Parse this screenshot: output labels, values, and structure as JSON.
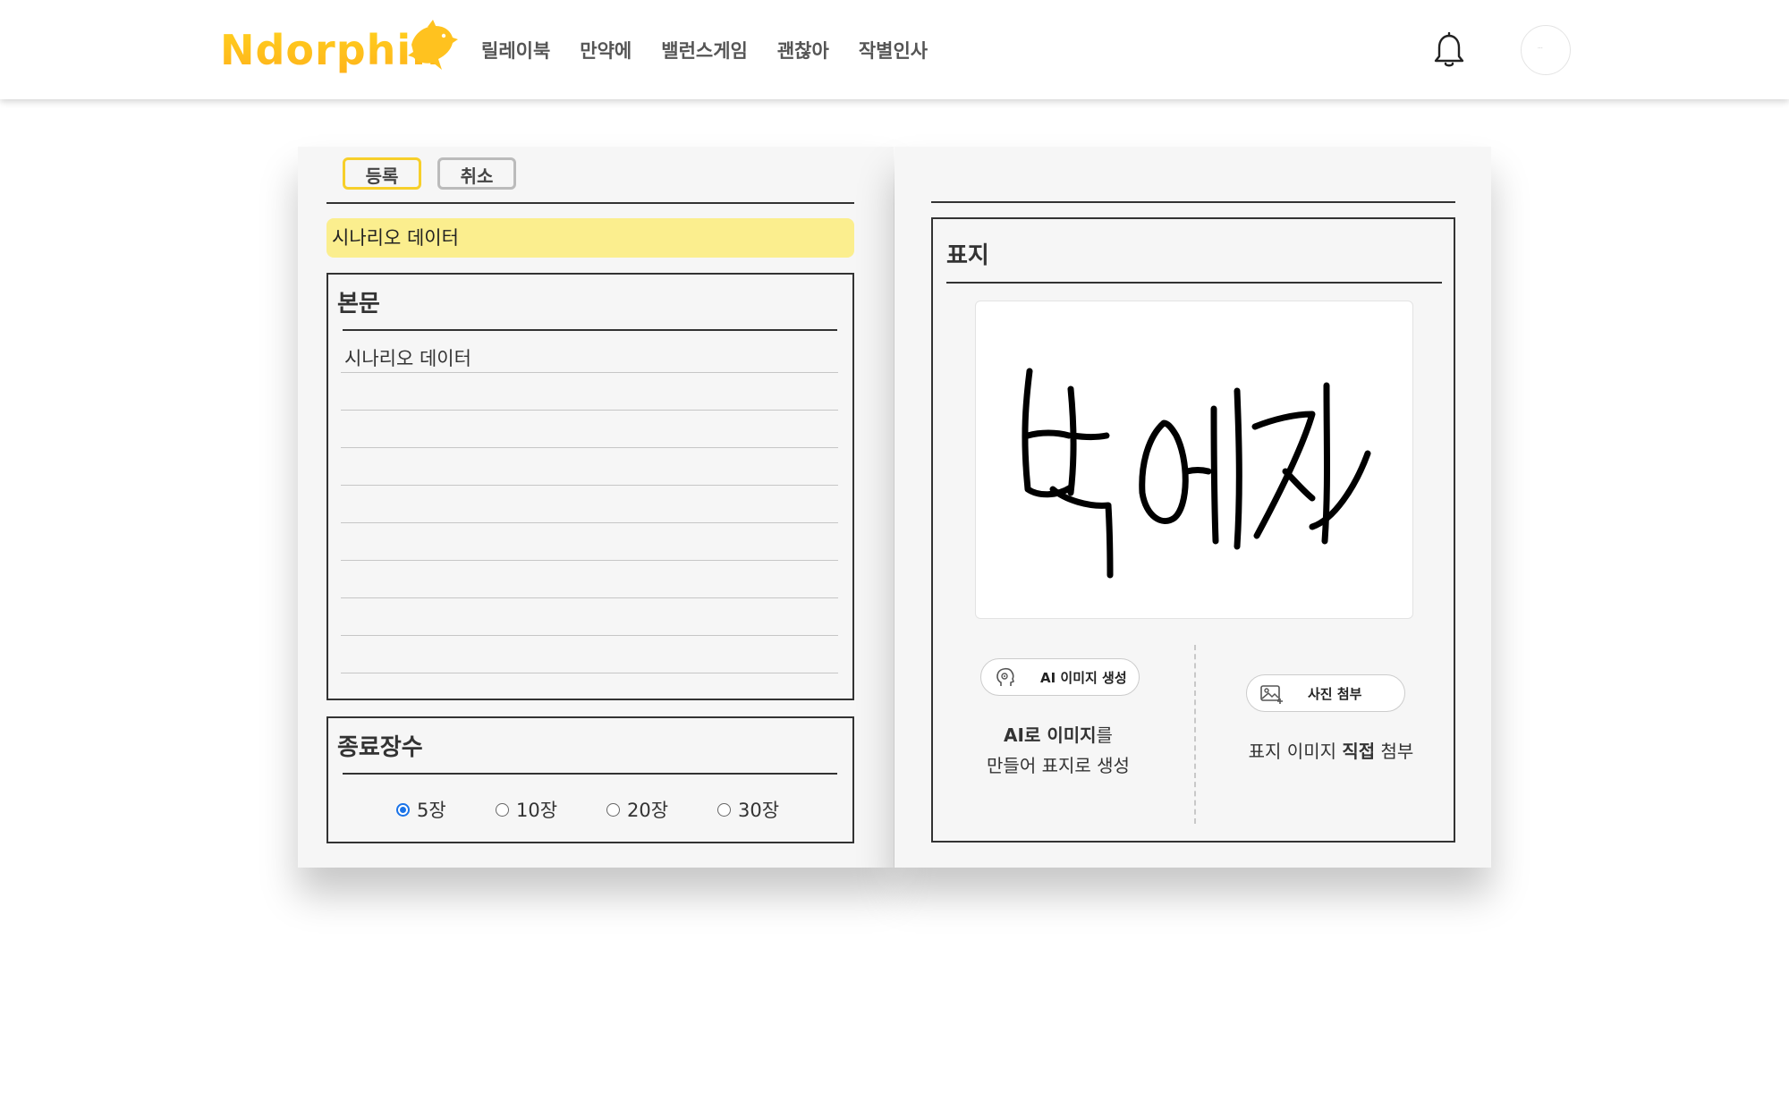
{
  "header": {
    "logo_text": "Ndorphin",
    "nav": [
      "릴레이북",
      "만약에",
      "밸런스게임",
      "괜찮아",
      "작별인사"
    ],
    "bell_icon": "bell-icon",
    "avatar_icon": "avatar"
  },
  "left_page": {
    "register_label": "등록",
    "cancel_label": "취소",
    "title_value": "시나리오 데이터",
    "body_title": "본문",
    "body_value": "시나리오 데이터",
    "end_title": "종료장수",
    "page_options": [
      {
        "label": "5장",
        "checked": true
      },
      {
        "label": "10장",
        "checked": false
      },
      {
        "label": "20장",
        "checked": false
      },
      {
        "label": "30장",
        "checked": false
      }
    ]
  },
  "right_page": {
    "cover_title": "표지",
    "cover_image_text": "박예지",
    "ai_button_label": "AI 이미지 생성",
    "ai_desc_bold": "AI로 이미지",
    "ai_desc_rest": "를",
    "ai_desc_line2": "만들어 표지로 생성",
    "photo_button_label": "사진 첨부",
    "photo_desc_pre": "표지 이미지 ",
    "photo_desc_bold": "직접",
    "photo_desc_post": " 첨부"
  },
  "colors": {
    "accent_yellow": "#f7cf2a",
    "title_bg": "#fbee8e",
    "page_bg": "#f6f6f6",
    "radio_checked": "#1a73e8"
  }
}
